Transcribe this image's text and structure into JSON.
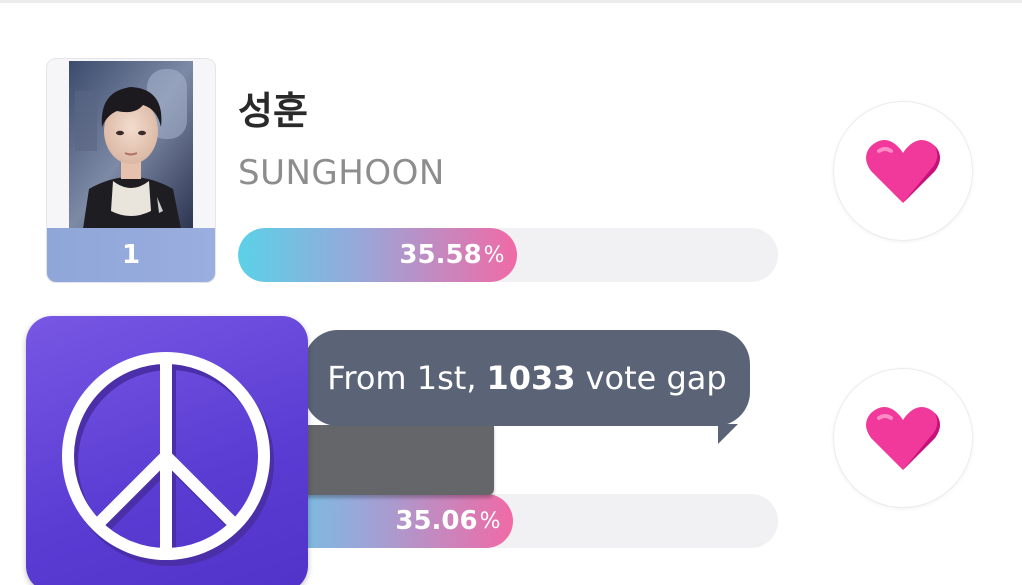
{
  "entries": [
    {
      "rank": "1",
      "name_kr": "성훈",
      "name_en": "SUNGHOON",
      "percent": "35.58",
      "percent_unit": "%",
      "percent_value": 35.58,
      "vote_icon": "heart-icon"
    },
    {
      "percent": "35.06",
      "percent_unit": "%",
      "percent_value": 35.06,
      "vote_icon": "heart-icon",
      "tooltip": {
        "prefix": "From 1st,",
        "gap": "1033",
        "suffix": "vote gap"
      }
    }
  ],
  "overlay_icon": "peace-sign-icon",
  "colors": {
    "bar_start": "#5bd1e8",
    "bar_end": "#f06aa6",
    "rank_strip": "#8fa6d8",
    "heart": "#f0399a",
    "tooltip_bg": "#5b6477",
    "peace_bg": "#6244d8"
  }
}
